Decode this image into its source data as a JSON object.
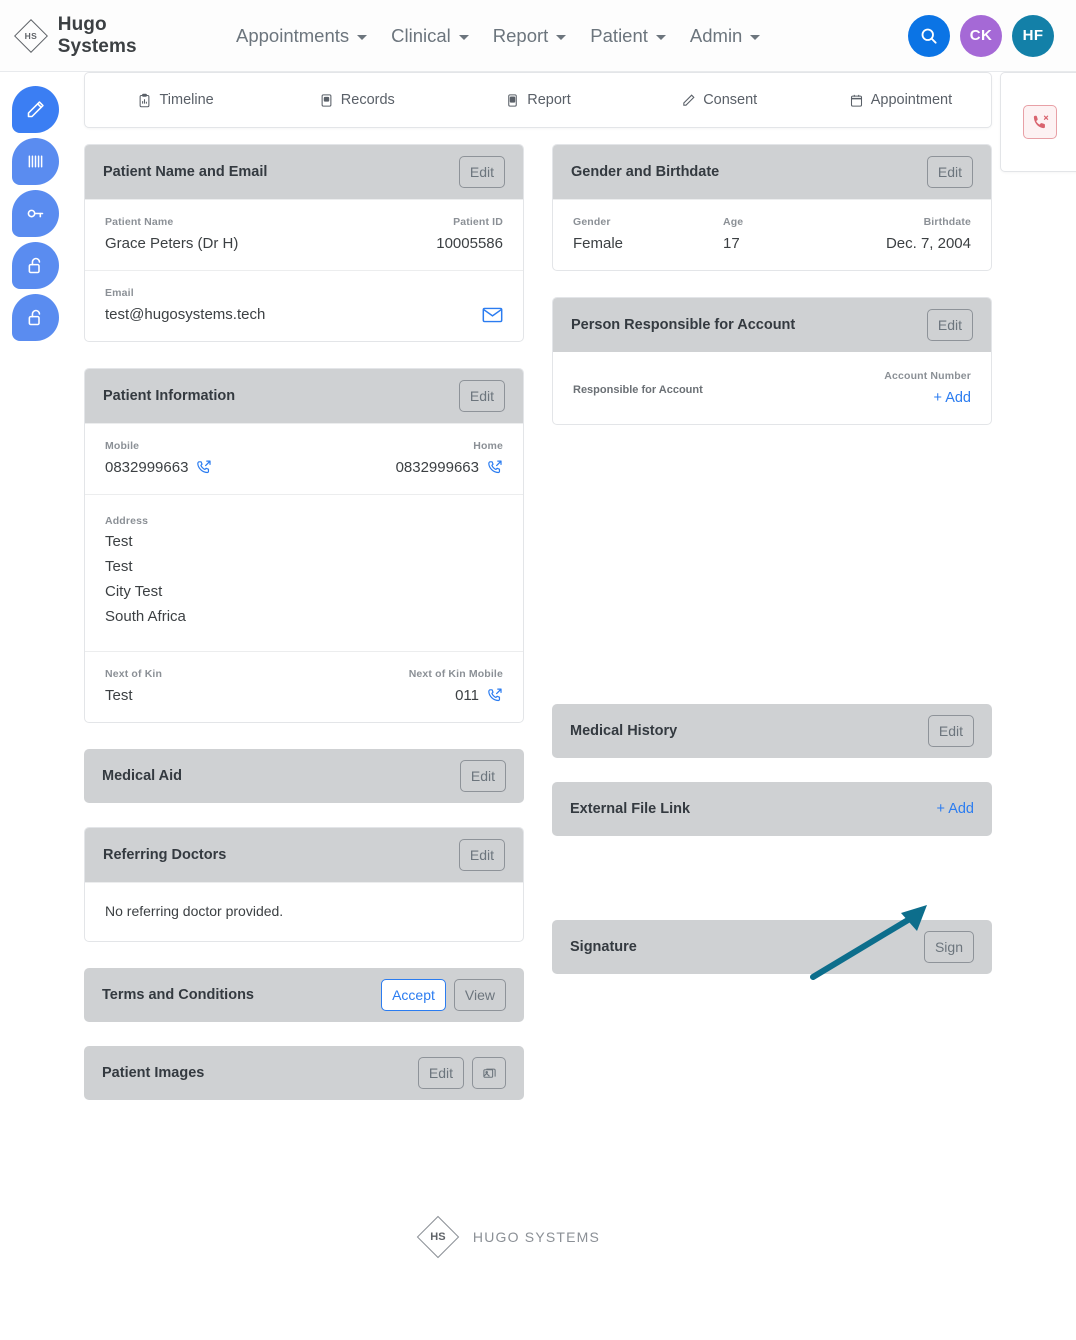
{
  "brand": {
    "mark": "HS",
    "name": "Hugo Systems"
  },
  "navbar": {
    "menus": [
      {
        "label": "Appointments"
      },
      {
        "label": "Clinical"
      },
      {
        "label": "Report"
      },
      {
        "label": "Patient"
      },
      {
        "label": "Admin"
      }
    ],
    "search_icon": "search-icon",
    "avatars": [
      {
        "initials": "CK",
        "color": "#a569d6"
      },
      {
        "initials": "HF",
        "color": "#1380a8"
      }
    ],
    "search_color": "#0b74e5"
  },
  "rail": [
    {
      "icon": "pencil-icon",
      "color": "#3b7ef3"
    },
    {
      "icon": "barcode-icon",
      "color": "#5a8cf0"
    },
    {
      "icon": "key-icon",
      "color": "#5a8cf0"
    },
    {
      "icon": "unlock-icon",
      "color": "#5a8cf0"
    },
    {
      "icon": "unlock-icon",
      "color": "#5a8cf0"
    }
  ],
  "tabs": [
    {
      "label": "Timeline",
      "icon": "clipboard-chart-icon"
    },
    {
      "label": "Records",
      "icon": "document-icon"
    },
    {
      "label": "Report",
      "icon": "report-icon"
    },
    {
      "label": "Consent",
      "icon": "pencil-icon"
    },
    {
      "label": "Appointment",
      "icon": "calendar-icon"
    }
  ],
  "call_panel": {
    "icon": "phone-missed-icon",
    "color": "#d9646f"
  },
  "cards": {
    "patient_name_email": {
      "title": "Patient Name and Email",
      "edit_label": "Edit",
      "name_label": "Patient Name",
      "name_value": "Grace Peters (Dr H)",
      "id_label": "Patient ID",
      "id_value": "10005586",
      "email_label": "Email",
      "email_value": "test@hugosystems.tech",
      "email_icon": "envelope-icon"
    },
    "gender_birthdate": {
      "title": "Gender and Birthdate",
      "edit_label": "Edit",
      "gender_label": "Gender",
      "gender_value": "Female",
      "age_label": "Age",
      "age_value": "17",
      "birthdate_label": "Birthdate",
      "birthdate_value": "Dec. 7, 2004"
    },
    "patient_information": {
      "title": "Patient Information",
      "edit_label": "Edit",
      "mobile_label": "Mobile",
      "mobile_value": "0832999663",
      "home_label": "Home",
      "home_value": "0832999663",
      "address_label": "Address",
      "address_lines": [
        "Test",
        "Test",
        "City Test",
        "South Africa"
      ],
      "kin_label": "Next of Kin",
      "kin_value": "Test",
      "kin_mobile_label": "Next of Kin Mobile",
      "kin_mobile_value": "011"
    },
    "person_responsible": {
      "title": "Person Responsible for Account",
      "edit_label": "Edit",
      "responsible_label": "Responsible for Account",
      "account_number_label": "Account Number",
      "add_label": "+  Add"
    },
    "medical_aid": {
      "title": "Medical Aid",
      "edit_label": "Edit"
    },
    "medical_history": {
      "title": "Medical History",
      "edit_label": "Edit"
    },
    "referring_doctors": {
      "title": "Referring Doctors",
      "edit_label": "Edit",
      "empty_text": "No referring doctor provided."
    },
    "external_file_link": {
      "title": "External File Link",
      "add_label": "+  Add"
    },
    "terms_conditions": {
      "title": "Terms and Conditions",
      "accept_label": "Accept",
      "view_label": "View"
    },
    "signature": {
      "title": "Signature",
      "sign_label": "Sign"
    },
    "patient_images": {
      "title": "Patient Images",
      "edit_label": "Edit",
      "image_icon": "photos-icon"
    }
  },
  "annotation": {
    "type": "arrow",
    "color": "#0d6e8c",
    "points_to": "external-file-link-add-button"
  },
  "footer": {
    "mark": "HS",
    "text": "HUGO SYSTEMS"
  }
}
